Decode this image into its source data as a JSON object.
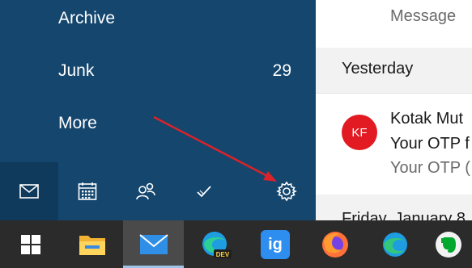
{
  "nav": {
    "items": [
      {
        "label": "Archive"
      },
      {
        "label": "Junk",
        "count": "29"
      },
      {
        "label": "More"
      }
    ],
    "bottom_icons": [
      "mail-icon",
      "calendar-icon",
      "people-icon",
      "todo-icon",
      "settings-icon"
    ]
  },
  "list": {
    "search_placeholder": "Message",
    "groups": [
      {
        "label": "Yesterday"
      },
      {
        "label": "Friday, January 8"
      }
    ],
    "message": {
      "avatar_initials": "KF",
      "avatar_color": "#e21b23",
      "sender": "Kotak Mut",
      "subject": "Your OTP f",
      "preview": "Your OTP ("
    }
  },
  "taskbar": {
    "apps": [
      "windows-start-icon",
      "file-explorer-icon",
      "mail-app-icon",
      "edge-dev-icon",
      "igdm-icon",
      "firefox-icon",
      "edge-icon",
      "evernote-icon"
    ],
    "edge_dev_badge": "DEV",
    "igdm_text": "ig"
  },
  "colors": {
    "nav_bg": "#14466e",
    "taskbar_bg": "#2b2b2b",
    "annotation_arrow": "#d9232a"
  }
}
